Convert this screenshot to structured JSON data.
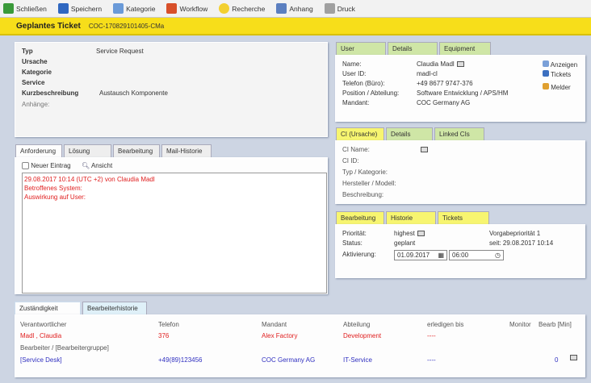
{
  "toolbar": {
    "items": [
      {
        "label": "Schließen",
        "icon": "close-icon",
        "color": "#3a9a3a"
      },
      {
        "label": "Speichern",
        "icon": "save-icon",
        "color": "#2f67c0"
      },
      {
        "label": "Kategorie",
        "icon": "category-icon",
        "color": "#6a9ad8"
      },
      {
        "label": "Workflow",
        "icon": "workflow-icon",
        "color": "#d8502a"
      },
      {
        "label": "Recherche",
        "icon": "lightbulb-icon",
        "color": "#f3d030"
      },
      {
        "label": "Anhang",
        "icon": "paperclip-icon",
        "color": "#5b7fc0"
      },
      {
        "label": "Druck",
        "icon": "printer-icon",
        "color": "#a0a0a0"
      }
    ]
  },
  "header": {
    "title": "Geplantes Ticket",
    "ticket_id": "COC-170829101405-CMa"
  },
  "ticket": {
    "typ_label": "Typ",
    "typ": "Service Request",
    "ursache_label": "Ursache",
    "kategorie_label": "Kategorie",
    "service_label": "Service",
    "kurz_label": "Kurzbeschreibung",
    "kurz": "Austausch Komponente",
    "anhaenge_label": "Anhänge:"
  },
  "left_tabs": [
    "Anforderung",
    "Lösung",
    "Bearbeitung",
    "Mail-Historie"
  ],
  "request": {
    "new_entry": "Neuer Eintrag",
    "view": "Ansicht",
    "lines": [
      "29.08.2017 10:14 (UTC +2) von Claudia Madl",
      "Betroffenes System:",
      "Auswirkung auf User:"
    ]
  },
  "user_tabs": [
    "User",
    "Details",
    "Equipment"
  ],
  "user": {
    "name_label": "Name:",
    "name": "Claudia Madl",
    "id_label": "User ID:",
    "id": "madl-cl",
    "tel_label": "Telefon (Büro):",
    "tel": "+49 8677 9747-376",
    "pos_label": "Position / Abteilung:",
    "pos": "Software Entwicklung",
    "dept": "APS/HM",
    "mandant_label": "Mandant:",
    "mandant": "COC Germany AG",
    "actions": [
      "Anzeigen",
      "Tickets",
      "Melder"
    ]
  },
  "ci_tabs": [
    "CI (Ursache)",
    "Details",
    "Linked CIs"
  ],
  "ci": {
    "labels": [
      "CI Name:",
      "CI ID:",
      "Typ / Kategorie:",
      "Hersteller / Modell:",
      "Beschreibung:"
    ]
  },
  "bearb_tabs": [
    "Bearbeitung",
    "Historie",
    "Tickets"
  ],
  "bearb": {
    "prio_label": "Priorität:",
    "prio": "highest",
    "default_prio": "Vorgabepriorität 1",
    "status_label": "Status:",
    "status": "geplant",
    "since": "seit: 29.08.2017 10:14",
    "activation_label": "Aktivierung:",
    "date": "01.09.2017",
    "time": "06:00"
  },
  "bottom_tabs": [
    "Zuständigkeit",
    "Bearbeiterhistorie"
  ],
  "resp": {
    "headers": [
      "Verantwortlicher",
      "Telefon",
      "Mandant",
      "Abteilung",
      "erledigen bis",
      "Monitor",
      "Bearb [Min]"
    ],
    "row1": [
      "Madl , Claudia",
      "376",
      "Alex Factory",
      "Development",
      "----"
    ],
    "group_label": "Bearbeiter / [Bearbeitergruppe]",
    "row2": [
      "[Service Desk]",
      "+49(89)123456",
      "COC Germany AG",
      "IT-Service",
      "----",
      "0"
    ]
  }
}
